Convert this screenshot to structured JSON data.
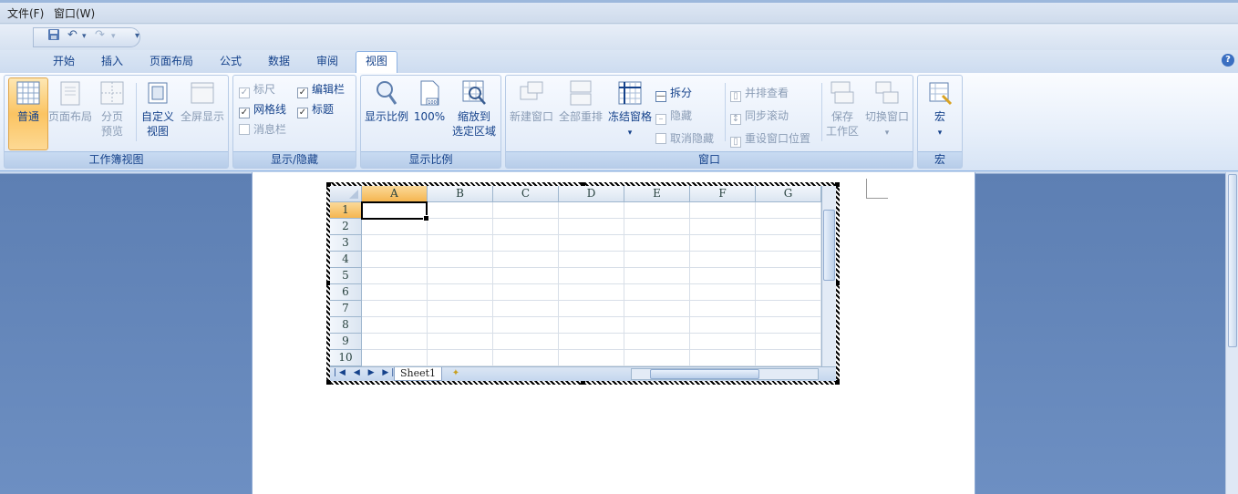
{
  "menubar": {
    "items": [
      "文件(F)",
      "窗口(W)"
    ]
  },
  "qat": {
    "save_icon": "save-icon",
    "undo_icon": "undo-icon",
    "redo_icon": "redo-icon",
    "customize": "▾"
  },
  "tabs": [
    {
      "label": "开始"
    },
    {
      "label": "插入"
    },
    {
      "label": "页面布局"
    },
    {
      "label": "公式"
    },
    {
      "label": "数据"
    },
    {
      "label": "审阅"
    },
    {
      "label": "视图",
      "active": true
    }
  ],
  "help": "?",
  "ribbon": {
    "workbook_views": {
      "label": "工作簿视图",
      "normal": "普通",
      "page_layout": "页面布局",
      "page_break_1": "分页",
      "page_break_2": "预览",
      "custom_1": "自定义",
      "custom_2": "视图",
      "fullscreen": "全屏显示"
    },
    "show_hide": {
      "label": "显示/隐藏",
      "ruler": "标尺",
      "formula_bar": "编辑栏",
      "gridlines": "网格线",
      "headings": "标题",
      "message_bar": "消息栏"
    },
    "zoom": {
      "label": "显示比例",
      "zoom": "显示比例",
      "hundred": "100%",
      "sel_1": "缩放到",
      "sel_2": "选定区域",
      "icon_100": "100"
    },
    "window": {
      "label": "窗口",
      "new_window": "新建窗口",
      "arrange_all": "全部重排",
      "freeze": "冻结窗格",
      "split": "拆分",
      "hide": "隐藏",
      "unhide": "取消隐藏",
      "side_by_side": "并排查看",
      "sync_scroll": "同步滚动",
      "reset_pos": "重设窗口位置",
      "save_ws_1": "保存",
      "save_ws_2": "工作区",
      "switch": "切换窗口"
    },
    "macros": {
      "label": "宏",
      "macros": "宏"
    }
  },
  "sheet": {
    "columns": [
      "A",
      "B",
      "C",
      "D",
      "E",
      "F",
      "G"
    ],
    "rows": [
      "1",
      "2",
      "3",
      "4",
      "5",
      "6",
      "7",
      "8",
      "9",
      "10"
    ],
    "active_cell": "A1",
    "sheet_tab": "Sheet1",
    "nav": "|◀ ◀ ▶ ▶|"
  },
  "colors": {
    "accent": "#15428b",
    "ribbon_border": "#8db2e3",
    "selection": "#f5b650"
  }
}
